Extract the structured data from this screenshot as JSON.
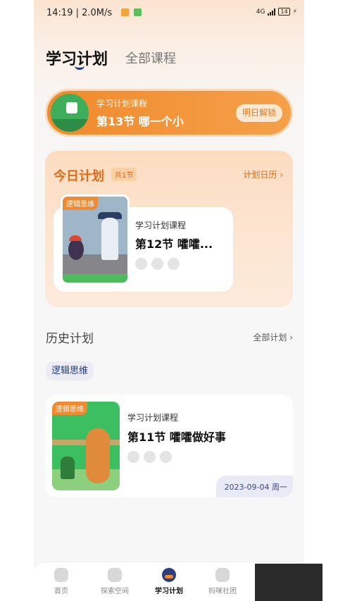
{
  "status_bar": {
    "time": "14:19",
    "net_speed": "2.0M/s",
    "network": "4G",
    "battery": "14"
  },
  "tabs": {
    "active": "学习计划",
    "inactive": "全部课程"
  },
  "banner": {
    "subtitle": "学习计划课程",
    "title": "第13节  哪一个小",
    "button": "明日解锁"
  },
  "today": {
    "title": "今日计划",
    "badge": "共1节",
    "link": "计划日历",
    "card": {
      "tag": "逻辑思维",
      "subtitle": "学习计划课程",
      "title": "第12节  嚯嚯..."
    }
  },
  "history": {
    "title": "历史计划",
    "link": "全部计划",
    "filter_chip": "逻辑思维",
    "card": {
      "tag": "逻辑思维",
      "subtitle": "学习计划课程",
      "title": "第11节  嚯嚯做好事",
      "date": "2023-09-04 周一"
    }
  },
  "bottom_nav": [
    {
      "label": "首页",
      "icon": "home-icon"
    },
    {
      "label": "探索空间",
      "icon": "explore-icon"
    },
    {
      "label": "学习计划",
      "icon": "study-plan-icon"
    },
    {
      "label": "妈咪社团",
      "icon": "community-icon"
    }
  ]
}
